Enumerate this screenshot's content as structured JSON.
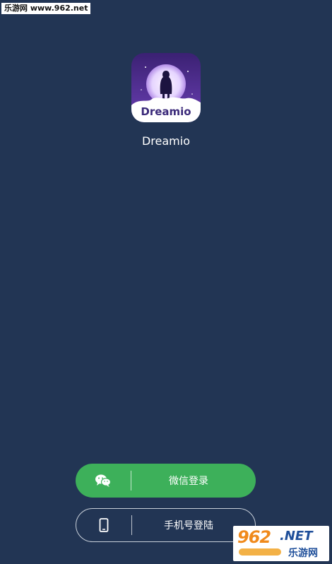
{
  "watermark": {
    "top_text": "乐游网 www.962.net",
    "brand_number": "962",
    "brand_suffix": ".NET",
    "brand_cn": "乐游网"
  },
  "app": {
    "name": "Dreamio",
    "icon_text": "Dreamio"
  },
  "login": {
    "wechat_label": "微信登录",
    "phone_label": "手机号登陆"
  },
  "colors": {
    "background": "#223554",
    "wechat_green": "#3db05a",
    "icon_purple": "#4a2e8c"
  },
  "icons": {
    "wechat": "wechat-icon",
    "phone": "phone-icon"
  }
}
